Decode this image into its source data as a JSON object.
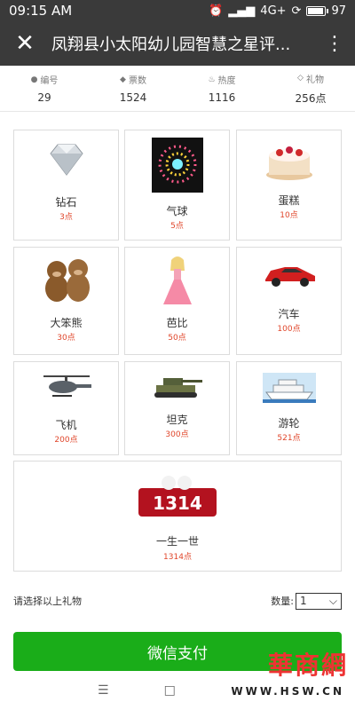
{
  "status_bar": {
    "time": "09:15 AM",
    "network": "4G+",
    "battery": "97",
    "battery_level": 0.97
  },
  "header": {
    "title": "凤翔县小太阳幼儿园智慧之星评...",
    "close_icon": "close-icon",
    "more_icon": "more-vertical-icon"
  },
  "stats": [
    {
      "label": "编号",
      "value": "29",
      "icon": "person-icon"
    },
    {
      "label": "票数",
      "value": "1524",
      "icon": "ticket-icon"
    },
    {
      "label": "热度",
      "value": "1116",
      "icon": "flame-icon"
    },
    {
      "label": "礼物",
      "value": "256点",
      "icon": "diamond-icon"
    }
  ],
  "gifts": [
    {
      "name": "钻石",
      "price": "3点",
      "icon": "diamond-icon"
    },
    {
      "name": "气球",
      "price": "5点",
      "icon": "firework-icon"
    },
    {
      "name": "蛋糕",
      "price": "10点",
      "icon": "cake-icon"
    },
    {
      "name": "大笨熊",
      "price": "30点",
      "icon": "bears-icon"
    },
    {
      "name": "芭比",
      "price": "50点",
      "icon": "doll-icon"
    },
    {
      "name": "汽车",
      "price": "100点",
      "icon": "car-icon"
    },
    {
      "name": "飞机",
      "price": "200点",
      "icon": "helicopter-icon"
    },
    {
      "name": "坦克",
      "price": "300点",
      "icon": "tank-icon"
    },
    {
      "name": "游轮",
      "price": "521点",
      "icon": "ship-icon"
    },
    {
      "name": "一生一世",
      "price": "1314点",
      "icon": "rose-box-icon"
    }
  ],
  "selection": {
    "prompt": "请选择以上礼物",
    "quantity_label": "数量:",
    "quantity_value": "1"
  },
  "pay_button": "微信支付",
  "watermark": {
    "brand": "華商網",
    "url": "WWW.HSW.CN"
  },
  "nav": {
    "menu_icon": "menu-icon",
    "home_icon": "home-square-icon"
  },
  "colors": {
    "header_bg": "#3a3a3a",
    "price_red": "#e0462b",
    "pay_green": "#1aad19"
  }
}
